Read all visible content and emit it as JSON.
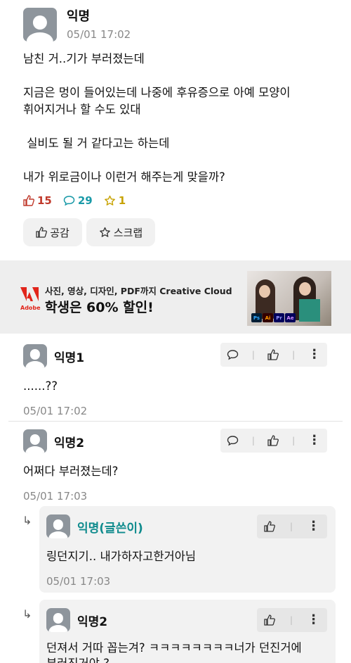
{
  "post": {
    "author": "익명",
    "time": "05/01 17:02",
    "lines": [
      "남친 거..기가 부러졌는데",
      "",
      "지금은 멍이 들어있는데 나중에 후유증으로 아예 모양이",
      "휘어지거나 할 수도 있대",
      "",
      " 실비도 될 거 같다고는 하는데",
      "",
      "내가 위로금이나 이런거 해주는게 맞을까?"
    ],
    "like_count": "15",
    "comment_count": "29",
    "scrap_count": "1",
    "like_button": "공감",
    "scrap_button": "스크랩"
  },
  "ad": {
    "logo_text": "Adobe",
    "line1": "사진, 영상, 디자인, PDF까지 Creative Cloud",
    "line2": "학생은 60% 할인!",
    "app_labels": [
      "Ps",
      "Ai",
      "Pr",
      "Ae"
    ],
    "colors": {
      "ps": "#001e36",
      "ai": "#e07a00",
      "pr": "#2d0f5b",
      "ae": "#2b1a5e",
      "adobe_red": "#e1251b"
    }
  },
  "comments": [
    {
      "author": "익명1",
      "text": "......??",
      "time": "05/01 17:02"
    },
    {
      "author": "익명2",
      "text": "어쩌다 부러졌는데?",
      "time": "05/01 17:03"
    }
  ],
  "replies": [
    {
      "author": "익명(글쓴이)",
      "text": "링던지기.. 내가하자고한거아님",
      "time": "05/01 17:03"
    },
    {
      "author": "익명2",
      "text": "던져서 거따 꼽는겨? ㅋㅋㅋㅋㅋㅋㅋㅋ너가 던진거에",
      "text2": "부러진거야 ?"
    }
  ],
  "icons": {
    "like": "thumbs-up-icon",
    "comment": "speech-bubble-icon",
    "scrap": "star-icon",
    "more": "more-vertical-icon",
    "reply": "reply-arrow-icon"
  },
  "colors": {
    "like": "#c0392b",
    "comment": "#1a9aa8",
    "scrap": "#c7a200",
    "writer": "#0f8b8d"
  }
}
